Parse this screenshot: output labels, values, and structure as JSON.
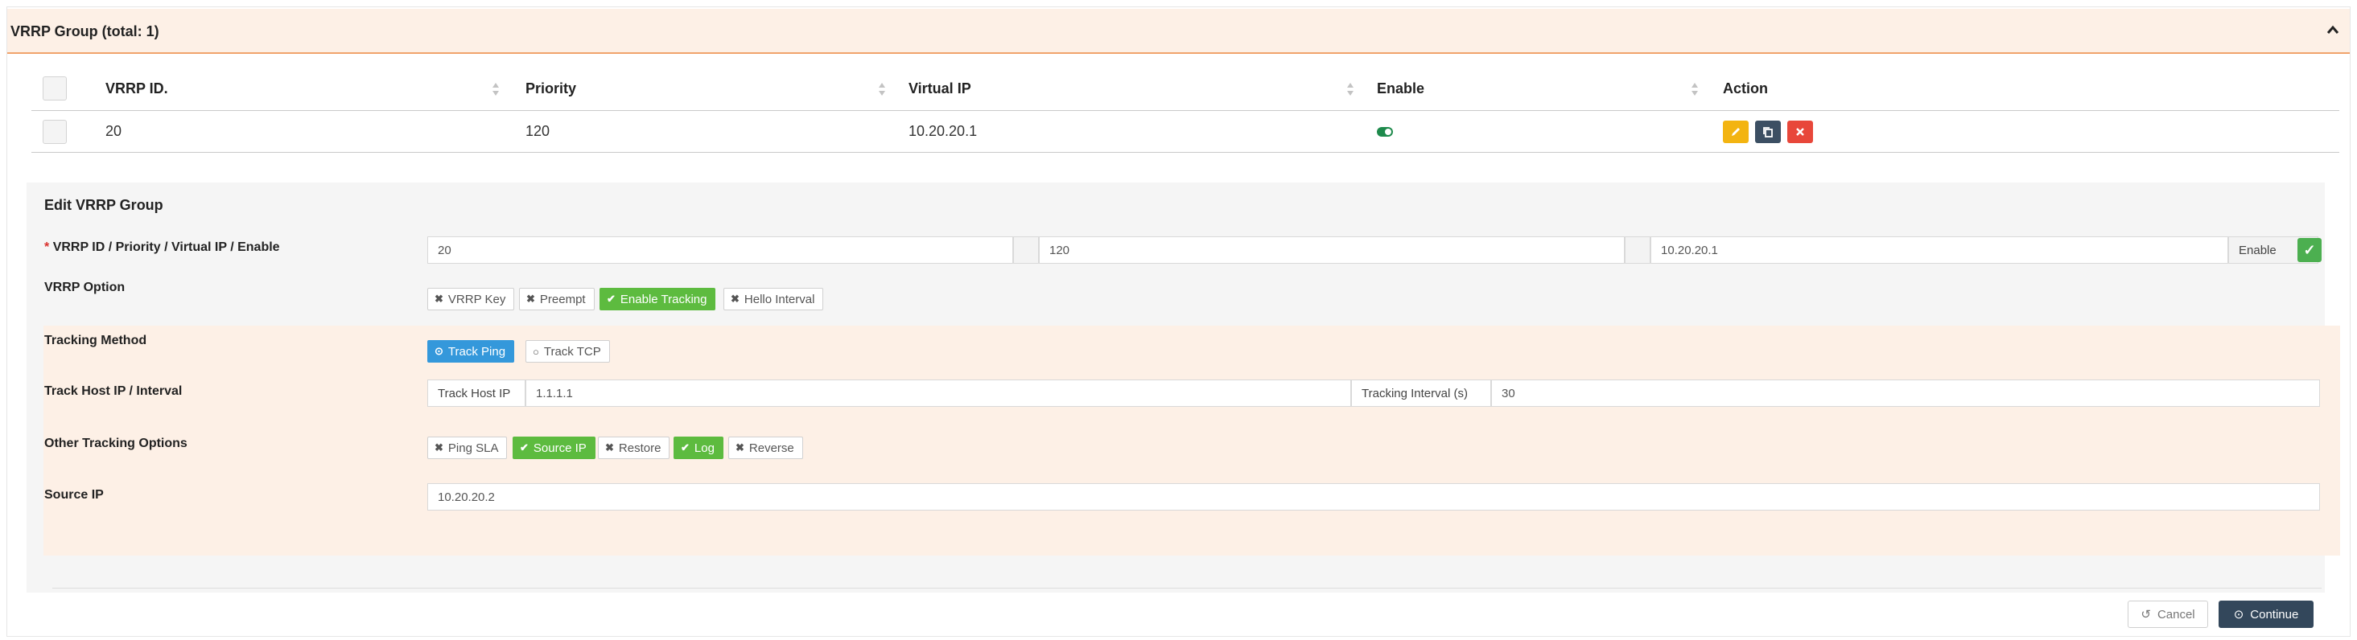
{
  "panel": {
    "title": "VRRP Group (total: 1)"
  },
  "table": {
    "headers": [
      "VRRP ID.",
      "Priority",
      "Virtual IP",
      "Enable",
      "Action"
    ],
    "rows": [
      {
        "vrrp_id": "20",
        "priority": "120",
        "virtual_ip": "10.20.20.1",
        "enabled": true
      }
    ]
  },
  "edit": {
    "title": "Edit VRRP Group",
    "row1": {
      "required_mark": "*",
      "label": "VRRP ID / Priority / Virtual IP / Enable",
      "vrrp_id": "20",
      "priority": "120",
      "virtual_ip": "10.20.20.1",
      "enable_label": "Enable",
      "enabled": true
    },
    "vrrp_option": {
      "label": "VRRP Option",
      "options": [
        {
          "label": "VRRP Key",
          "active": false
        },
        {
          "label": "Preempt",
          "active": false
        },
        {
          "label": "Enable Tracking",
          "active": true
        },
        {
          "label": "Hello Interval",
          "active": false
        }
      ]
    },
    "tracking_method": {
      "label": "Tracking Method",
      "options": [
        {
          "label": "Track Ping",
          "selected": true
        },
        {
          "label": "Track TCP",
          "selected": false
        }
      ]
    },
    "track_host": {
      "label": "Track Host IP / Interval",
      "host_addon": "Track Host IP",
      "host_value": "1.1.1.1",
      "interval_addon": "Tracking Interval (s)",
      "interval_value": "30"
    },
    "other_tracking": {
      "label": "Other Tracking Options",
      "options": [
        {
          "label": "Ping SLA",
          "active": false
        },
        {
          "label": "Source IP",
          "active": true
        },
        {
          "label": "Restore",
          "active": false
        },
        {
          "label": "Log",
          "active": true
        },
        {
          "label": "Reverse",
          "active": false
        }
      ]
    },
    "source_ip": {
      "label": "Source IP",
      "value": "10.20.20.2"
    }
  },
  "footer": {
    "cancel_label": "Cancel",
    "continue_label": "Continue"
  },
  "colors": {
    "accent_orange": "#f0a36b",
    "active_green": "#5dbb3f",
    "selected_blue": "#3498db",
    "primary_dark": "#33475b",
    "edit_yellow": "#f3b411",
    "delete_red": "#e8473a"
  },
  "icons": [
    "chevron-up-icon",
    "sort-icon",
    "toggle-icon",
    "pencil-icon",
    "copy-icon",
    "close-icon",
    "check-icon",
    "x-icon",
    "radio-icon",
    "undo-icon",
    "continue-icon"
  ]
}
